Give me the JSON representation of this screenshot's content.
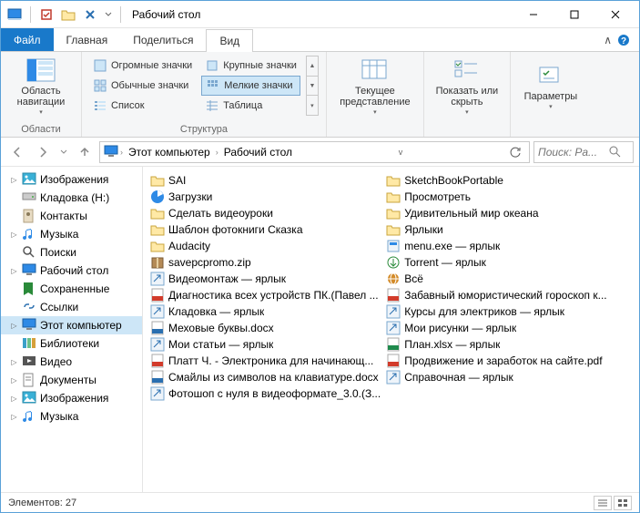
{
  "titlebar": {
    "title": "Рабочий стол"
  },
  "tabs": {
    "file": "Файл",
    "main": "Главная",
    "share": "Поделиться",
    "view": "Вид"
  },
  "ribbon": {
    "panes_group": "Области",
    "nav_pane": "Область навигации",
    "layout_group": "Структура",
    "layouts": {
      "extra_large": "Огромные значки",
      "large": "Крупные значки",
      "medium": "Обычные значки",
      "small": "Мелкие значки",
      "list": "Список",
      "table": "Таблица"
    },
    "current_view": "Текущее представление",
    "show_hide": "Показать или скрыть",
    "options": "Параметры"
  },
  "breadcrumb": {
    "root": "Этот компьютер",
    "leaf": "Рабочий стол"
  },
  "search": {
    "placeholder": "Поиск: Ра..."
  },
  "tree": [
    {
      "icon": "pictures",
      "label": "Изображения",
      "twisty": "▷"
    },
    {
      "icon": "drive",
      "label": "Кладовка (H:)",
      "twisty": ""
    },
    {
      "icon": "contacts",
      "label": "Контакты",
      "twisty": ""
    },
    {
      "icon": "music",
      "label": "Музыка",
      "twisty": "▷"
    },
    {
      "icon": "search",
      "label": "Поиски",
      "twisty": ""
    },
    {
      "icon": "desktop",
      "label": "Рабочий стол",
      "twisty": "▷"
    },
    {
      "icon": "saved",
      "label": "Сохраненные",
      "twisty": ""
    },
    {
      "icon": "links",
      "label": "Ссылки",
      "twisty": ""
    },
    {
      "icon": "pc",
      "label": "Этот компьютер",
      "twisty": "▷",
      "selected": true
    },
    {
      "icon": "libs",
      "label": "Библиотеки",
      "twisty": ""
    },
    {
      "icon": "video",
      "label": "Видео",
      "twisty": "▷"
    },
    {
      "icon": "docs",
      "label": "Документы",
      "twisty": "▷"
    },
    {
      "icon": "pictures",
      "label": "Изображения",
      "twisty": "▷"
    },
    {
      "icon": "music",
      "label": "Музыка",
      "twisty": "▷"
    }
  ],
  "files_left": [
    {
      "icon": "folder",
      "name": "SAI"
    },
    {
      "icon": "chart",
      "name": "Загрузки"
    },
    {
      "icon": "folder",
      "name": "Сделать видеоуроки"
    },
    {
      "icon": "folder",
      "name": "Шаблон фотокниги Сказка"
    },
    {
      "icon": "folder",
      "name": "Audacity"
    },
    {
      "icon": "zip",
      "name": "savepcpromo.zip"
    },
    {
      "icon": "shortcut",
      "name": "Видеомонтаж — ярлык"
    },
    {
      "icon": "pdf",
      "name": "Диагностика всех устройств ПК.(Павел ..."
    },
    {
      "icon": "shortcut",
      "name": "Кладовка — ярлык"
    },
    {
      "icon": "docx",
      "name": "Меховые буквы.docx"
    },
    {
      "icon": "shortcut",
      "name": "Мои статьи — ярлык"
    },
    {
      "icon": "pdf",
      "name": "Платт Ч. - Электроника для начинающ..."
    },
    {
      "icon": "docx",
      "name": "Смайлы из символов на клавиатуре.docx"
    },
    {
      "icon": "shortcut",
      "name": "Фотошоп с нуля в видеоформате_3.0.(З..."
    }
  ],
  "files_right": [
    {
      "icon": "folder",
      "name": "SketchBookPortable"
    },
    {
      "icon": "folder",
      "name": "Просмотреть"
    },
    {
      "icon": "folder",
      "name": "Удивительный мир океана"
    },
    {
      "icon": "folder",
      "name": "Ярлыки"
    },
    {
      "icon": "exe",
      "name": "menu.exe — ярлык"
    },
    {
      "icon": "torrent",
      "name": "Torrent — ярлык"
    },
    {
      "icon": "globe",
      "name": "Всё"
    },
    {
      "icon": "pdf",
      "name": "Забавный юмористический гороскоп к..."
    },
    {
      "icon": "shortcut",
      "name": "Курсы для электриков — ярлык"
    },
    {
      "icon": "shortcut",
      "name": "Мои рисунки — ярлык"
    },
    {
      "icon": "xlsx",
      "name": "План.xlsx — ярлык"
    },
    {
      "icon": "pdf",
      "name": "Продвижение и заработок на сайте.pdf"
    },
    {
      "icon": "shortcut",
      "name": "Справочная — ярлык"
    }
  ],
  "status": {
    "count_label": "Элементов: 27"
  }
}
